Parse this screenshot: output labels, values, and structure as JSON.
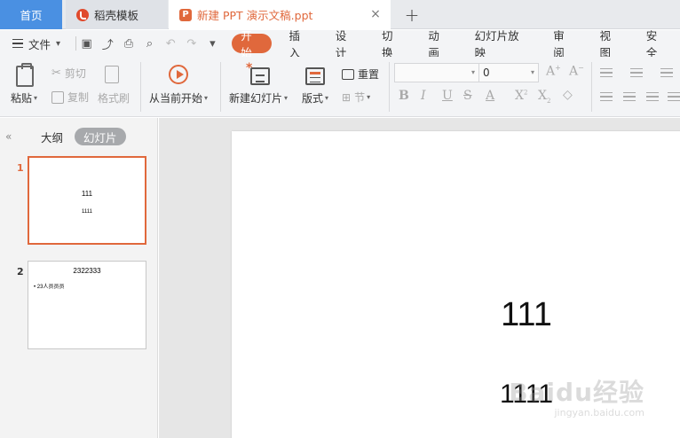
{
  "tabs": {
    "home": "首页",
    "template": "稻壳模板",
    "document": "新建 PPT 演示文稿.ppt",
    "add": "+",
    "close": "×"
  },
  "menu": {
    "file": "文件",
    "tabs": [
      "开始",
      "插入",
      "设计",
      "切换",
      "动画",
      "幻灯片放映",
      "审阅",
      "视图",
      "安全"
    ],
    "active_tab": "开始"
  },
  "ribbon": {
    "paste": "粘贴",
    "cut": "剪切",
    "copy": "复制",
    "format_painter": "格式刷",
    "from_current": "从当前开始",
    "new_slide": "新建幻灯片",
    "layout": "版式",
    "reset": "重置",
    "section": "节",
    "font_name": "",
    "font_size": "0"
  },
  "panel": {
    "outline_tab": "大纲",
    "slides_tab": "幻灯片",
    "slides": [
      {
        "number": "1",
        "title": "111",
        "subtitle": "1111",
        "active": true
      },
      {
        "number": "2",
        "title": "2322333",
        "bullet": "• 23人员员员",
        "active": false
      }
    ]
  },
  "slide": {
    "title": "111",
    "subtitle": "1111"
  },
  "watermark": {
    "text": "Baidu经验",
    "sub": "jingyan.baidu.com"
  },
  "colors": {
    "accent": "#e0683c",
    "home_tab": "#4a90e2"
  }
}
